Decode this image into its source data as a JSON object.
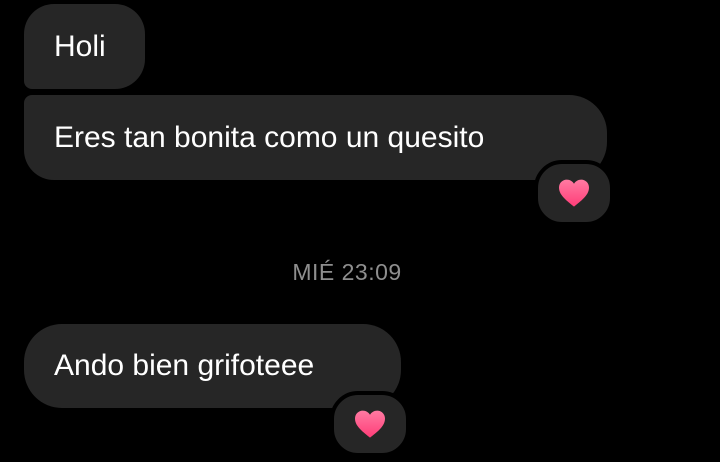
{
  "conversation": {
    "messages": [
      {
        "text": "Holi"
      },
      {
        "text": "Eres tan bonita como un quesito",
        "reaction": "heart-icon"
      },
      {
        "text": "Ando bien grifoteee",
        "reaction": "heart-icon"
      }
    ],
    "timestamp": "MIÉ 23:09"
  },
  "colors": {
    "background": "#000000",
    "bubble": "#262626",
    "text": "#ffffff",
    "timestamp": "#8e8e8e",
    "heart": "#ff5a8a"
  }
}
